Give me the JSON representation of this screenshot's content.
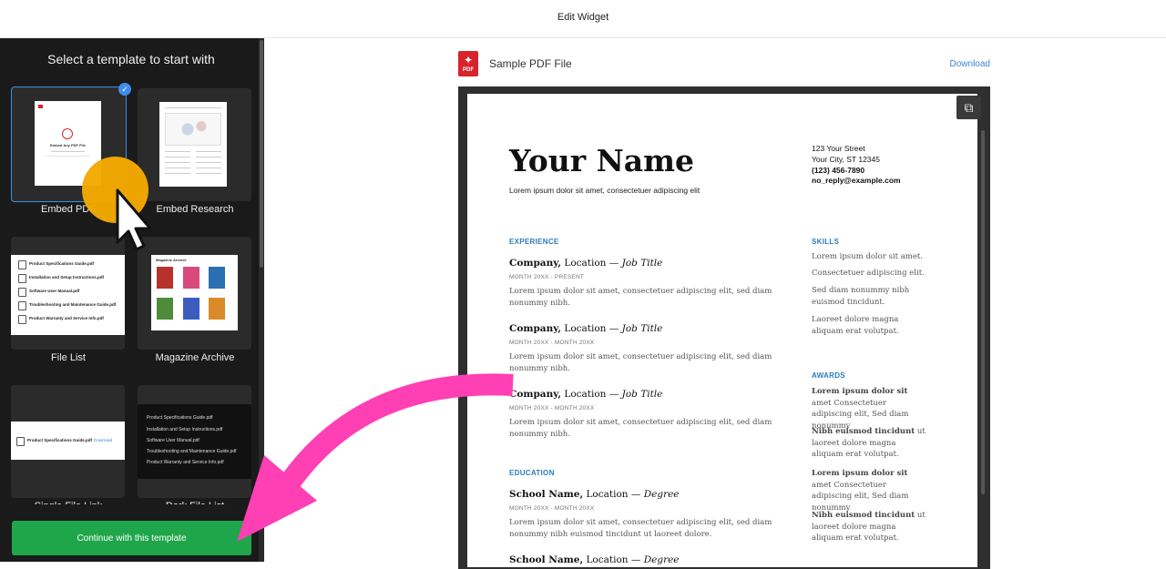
{
  "topbar": {
    "title": "Edit Widget"
  },
  "sidebar": {
    "heading": "Select a template to start with",
    "templates": [
      {
        "label": "Embed PDF",
        "selected": true
      },
      {
        "label": "Embed Research",
        "selected": false
      },
      {
        "label": "File List",
        "selected": false
      },
      {
        "label": "Magazine Archive",
        "selected": false
      },
      {
        "label": "Single File Link",
        "selected": false
      },
      {
        "label": "Dark File List",
        "selected": false
      }
    ],
    "embed_pdf_thumb": {
      "title": "Embed Any PDF File"
    },
    "file_list_items": [
      "Product Specifications Guide.pdf",
      "Installation and Setup Instructions.pdf",
      "Software User Manual.pdf",
      "Troubleshooting and Maintenance Guide.pdf",
      "Product Warranty and Service Info.pdf"
    ],
    "magazine_thumb": {
      "title": "Magazine Archive"
    },
    "single_file": {
      "name": "Product Specifications Guide.pdf",
      "action": "Download"
    },
    "dark_file_list_items": [
      "Product Specifications Guide.pdf",
      "Installation and Setup Instructions.pdf",
      "Software User Manual.pdf",
      "Troubleshooting and Maintenance Guide.pdf",
      "Product Warranty and Service Info.pdf"
    ],
    "continue_label": "Continue with this template"
  },
  "preview": {
    "file_icon": "PDF",
    "file_title": "Sample PDF File",
    "download_label": "Download",
    "resume": {
      "name": "Your Name",
      "tagline": "Lorem ipsum dolor sit amet, consectetuer adipiscing elit",
      "address": [
        "123 Your Street",
        "Your City, ST 12345"
      ],
      "phone": "(123) 456-7890",
      "email": "no_reply@example.com",
      "experience_heading": "EXPERIENCE",
      "jobs": [
        {
          "company": "Company,",
          "location": " Location — ",
          "title": "Job Title",
          "dates": "MONTH 20XX - PRESENT",
          "desc": "Lorem ipsum dolor sit amet, consectetuer adipiscing elit, sed diam nonummy nibh."
        },
        {
          "company": "Company,",
          "location": " Location — ",
          "title": "Job Title",
          "dates": "MONTH 20XX - MONTH 20XX",
          "desc": "Lorem ipsum dolor sit amet, consectetuer adipiscing elit, sed diam nonummy nibh."
        },
        {
          "company": "Company,",
          "location": " Location — ",
          "title": "Job Title",
          "dates": "MONTH 20XX - MONTH 20XX",
          "desc": "Lorem ipsum dolor sit amet, consectetuer adipiscing elit, sed diam nonummy nibh."
        }
      ],
      "education_heading": "EDUCATION",
      "schools": [
        {
          "school": "School Name,",
          "location": " Location — ",
          "degree": "Degree",
          "dates": "MONTH 20XX - MONTH 20XX",
          "desc": "Lorem ipsum dolor sit amet, consectetuer adipiscing elit, sed diam nonummy nibh euismod tincidunt ut laoreet dolore."
        },
        {
          "school": "School Name,",
          "location": " Location — ",
          "degree": "Degree"
        }
      ],
      "skills_heading": "SKILLS",
      "skills": [
        "Lorem ipsum dolor sit amet.",
        "Consectetuer adipiscing elit.",
        "Sed diam nonummy nibh euismod tincidunt.",
        "Laoreet dolore magna aliquam erat volutpat."
      ],
      "awards_heading": "AWARDS",
      "awards": [
        {
          "bold": "Lorem ipsum dolor sit",
          "rest": " amet Consectetuer adipiscing elit, Sed diam nonummy"
        },
        {
          "bold": "Nibh euismod tincidunt",
          "rest": " ut laoreet dolore magna aliquam erat volutpat."
        },
        {
          "bold": "Lorem ipsum dolor sit",
          "rest": " amet Consectetuer adipiscing elit, Sed diam nonummy"
        },
        {
          "bold": "Nibh euismod tincidunt",
          "rest": " ut laoreet dolore magna aliquam erat volutpat."
        }
      ]
    }
  },
  "colors": {
    "accent": "#3d8ee8",
    "continue": "#1fa64a",
    "arrow": "#ff3fb4",
    "cursor_dot": "#f4a900"
  }
}
